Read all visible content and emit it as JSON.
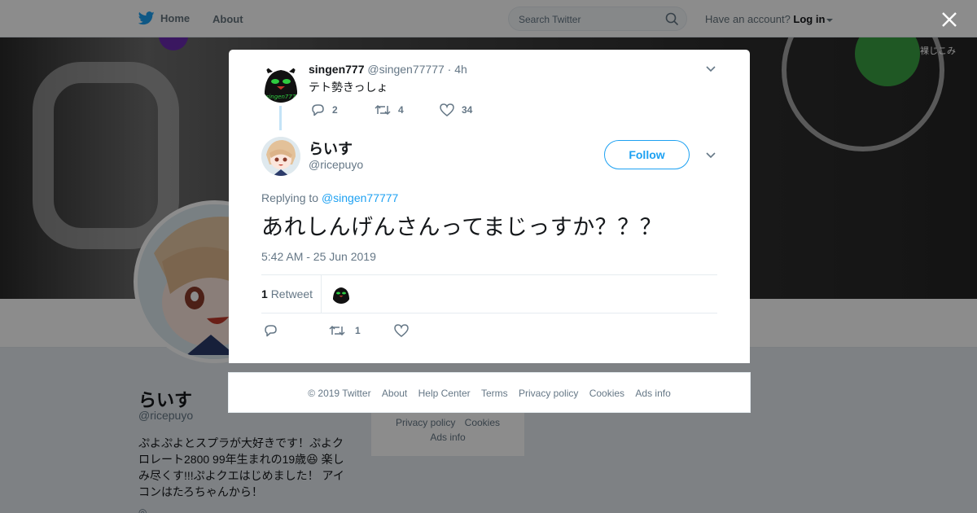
{
  "nav": {
    "home_label": "Home",
    "about_label": "About",
    "search_placeholder": "Search Twitter",
    "account_prompt": "Have an account?",
    "login_label": "Log in"
  },
  "banner": {
    "corner_text": "裸じこみ"
  },
  "profile": {
    "name": "らいす",
    "handle": "@ricepuyo",
    "bio": "ぷよぷよとスプラが大好きです！ぷよクロレート2800 99年生まれの19歳😆 楽しみ尽くす!!!ぷよクエはじめました！ アイコンはたろちゃんから！",
    "footer_links": [
      "Privacy policy",
      "Cookies",
      "Ads info"
    ]
  },
  "context_tweet": {
    "name": "singen777",
    "handle": "@singen77777",
    "time": "· 4h",
    "text": "テト勢きっしょ",
    "replies": "2",
    "retweets": "4",
    "likes": "34"
  },
  "main_tweet": {
    "name": "らいす",
    "handle": "@ricepuyo",
    "follow_label": "Follow",
    "replying_prefix": "Replying to",
    "replying_to": "@singen77777",
    "text": "あれしんげんさんってまじっすか？？？",
    "timestamp": "5:42 AM - 25 Jun 2019",
    "retweet_count": "1",
    "retweet_label": "Retweet",
    "action_retweets": "1"
  },
  "footer": {
    "copyright": "© 2019 Twitter",
    "links": [
      "About",
      "Help Center",
      "Terms",
      "Privacy policy",
      "Cookies",
      "Ads info"
    ]
  },
  "colors": {
    "accent": "#1da1f2",
    "text": "#14171a",
    "muted": "#657786"
  }
}
